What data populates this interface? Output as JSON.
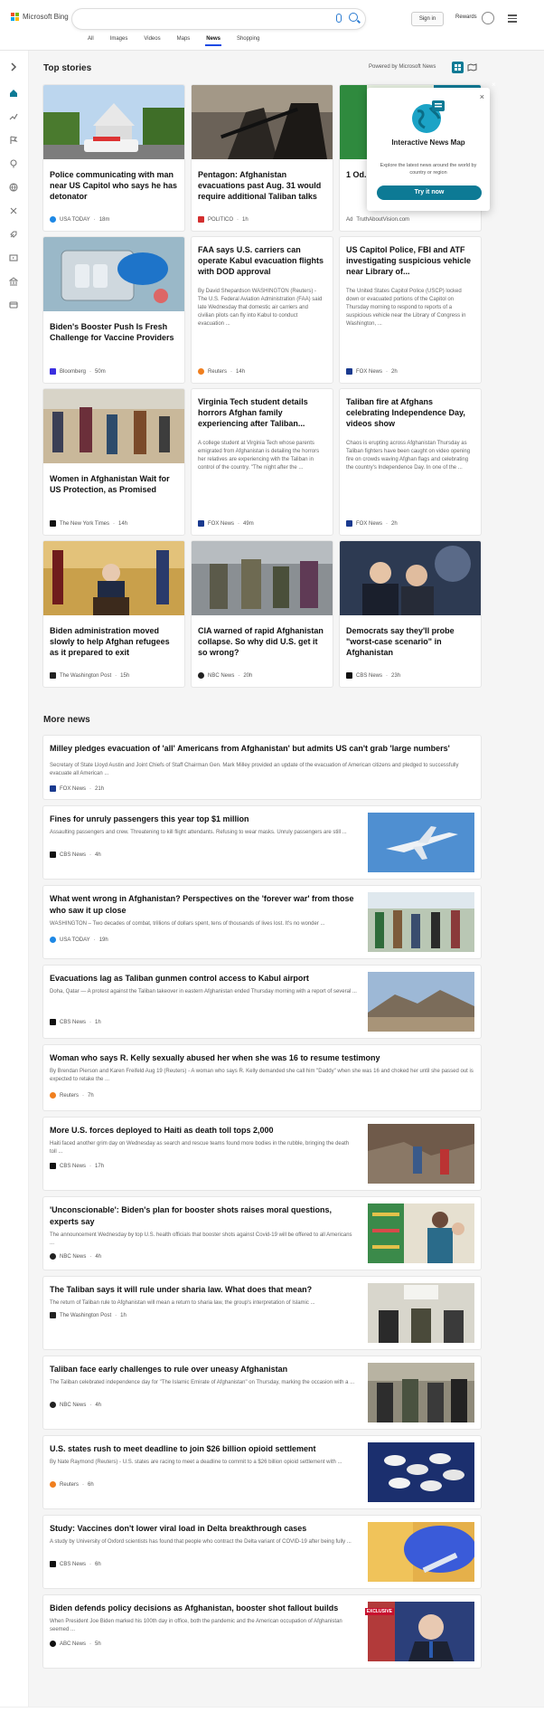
{
  "header": {
    "logo_text": "Microsoft Bing",
    "signin": "Sign in",
    "rewards": "Rewards",
    "brand_colors": [
      "#f25022",
      "#7fba00",
      "#00a4ef",
      "#ffb900"
    ]
  },
  "nav": [
    {
      "label": "All"
    },
    {
      "label": "Images"
    },
    {
      "label": "Videos"
    },
    {
      "label": "Maps"
    },
    {
      "label": "News",
      "active": true
    },
    {
      "label": "Shopping"
    }
  ],
  "top_stories": {
    "heading": "Top stories",
    "powered_by": "Powered by Microsoft News",
    "cards": [
      {
        "title": "Police communicating with man near US Capitol who says he has detonator",
        "source": "USA TODAY",
        "age": "18m",
        "logo_color": "#1e88e5"
      },
      {
        "title": "Pentagon: Afghanistan evacuations past Aug. 31 would require additional Taliban talks",
        "source": "POLITICO",
        "age": "1h",
        "logo_color": "#d32f2f"
      },
      {
        "title": "1 Od... To P...",
        "source": "TruthAboutVision.com",
        "ad_label": "Ad",
        "logo_color": "#999999"
      },
      {
        "title": "Biden's Booster Push Is Fresh Challenge for Vaccine Providers",
        "source": "Bloomberg",
        "age": "50m",
        "logo_color": "#3b2fe0"
      },
      {
        "title": "FAA says U.S. carriers can operate Kabul evacuation flights with DOD approval",
        "snippet": "By David Shepardson WASHINGTON (Reuters) -The U.S. Federal Aviation Administration (FAA) said late Wednesday that domestic air carriers and civilian pilots can fly into Kabul to conduct evacuation ...",
        "source": "Reuters",
        "age": "14h",
        "logo_color": "#f07f1f"
      },
      {
        "title": "US Capitol Police, FBI and ATF investigating suspicious vehicle near Library of...",
        "snippet": "The United States Capitol Police (USCP) locked down or evacuated portions of the Capitol on Thursday morning to respond to reports of a suspicious vehicle near the Library of Congress in Washington, ...",
        "source": "FOX News",
        "age": "2h",
        "logo_color": "#1a3a8f"
      },
      {
        "title": "Women in Afghanistan Wait for US Protection, as Promised",
        "source": "The New York Times",
        "age": "14h",
        "logo_color": "#111111"
      },
      {
        "title": "Virginia Tech student details horrors Afghan family experiencing after Taliban...",
        "snippet": "A college student at Virginia Tech whose parents emigrated from Afghanistan is detailing the horrors her relatives are experiencing with the Taliban in control of the country. \"The night after the ...",
        "source": "FOX News",
        "age": "49m",
        "logo_color": "#1a3a8f"
      },
      {
        "title": "Taliban fire at Afghans celebrating Independence Day, videos show",
        "snippet": "Chaos is erupting across Afghanistan Thursday as Taliban fighters have been caught on video opening fire on crowds waving Afghan flags and celebrating the country's Independence Day. In one of the ...",
        "source": "FOX News",
        "age": "2h",
        "logo_color": "#1a3a8f"
      },
      {
        "title": "Biden administration moved slowly to help Afghan refugees as it prepared to exit",
        "source": "The Washington Post",
        "age": "15h",
        "logo_color": "#222222"
      },
      {
        "title": "CIA warned of rapid Afghanistan collapse. So why did U.S. get it so wrong?",
        "source": "NBC News",
        "age": "20h",
        "logo_color": "#222222"
      },
      {
        "title": "Democrats say they'll probe \"worst-case scenario\" in Afghanistan",
        "source": "CBS News",
        "age": "23h",
        "logo_color": "#111111"
      }
    ]
  },
  "popup": {
    "title": "Interactive News Map",
    "description": "Explore the latest news around the world by country or region",
    "button": "Try it now"
  },
  "more_news": {
    "heading": "More news",
    "items": [
      {
        "title": "Milley pledges evacuation of 'all' Americans from Afghanistan' but admits US can't grab 'large numbers'",
        "snippet": "Secretary of State Lloyd Austin and Joint Chiefs of Staff Chairman Gen. Mark Milley provided an update of the evacuation of American citizens and pledged to successfully evacuate all American ...",
        "source": "FOX News",
        "age": "21h",
        "logo_color": "#1a3a8f",
        "has_image": false
      },
      {
        "title": "Fines for unruly passengers this year top $1 million",
        "snippet": "Assaulting passengers and crew. Threatening to kill flight attendants. Refusing to wear masks. Unruly passengers are still ...",
        "source": "CBS News",
        "age": "4h",
        "logo_color": "#111111",
        "has_image": true
      },
      {
        "title": "What went wrong in Afghanistan? Perspectives on the 'forever war' from those who saw it up close",
        "snippet": "WASHINGTON – Two decades of combat, trillions of dollars spent, tens of thousands of lives lost. It's no wonder ...",
        "source": "USA TODAY",
        "age": "19h",
        "logo_color": "#1e88e5",
        "has_image": true
      },
      {
        "title": "Evacuations lag as Taliban gunmen control access to Kabul airport",
        "snippet": "Doha, Qatar — A protest against the Taliban takeover in eastern Afghanistan ended Thursday morning with a report of several ...",
        "source": "CBS News",
        "age": "1h",
        "logo_color": "#111111",
        "has_image": true
      },
      {
        "title": "Woman who says R. Kelly sexually abused her when she was 16 to resume testimony",
        "snippet": "By Brendan Pierson and Karen Freifeld Aug 19 (Reuters) - A woman who says R. Kelly demanded she call him \"Daddy\" when she was 16 and choked her until she passed out is expected to retake the ...",
        "source": "Reuters",
        "age": "7h",
        "logo_color": "#f07f1f",
        "has_image": false
      },
      {
        "title": "More U.S. forces deployed to Haiti as death toll tops 2,000",
        "snippet": "Haiti faced another grim day on Wednesday as search and rescue teams found more bodies in the rubble, bringing the death toll ...",
        "source": "CBS News",
        "age": "17h",
        "logo_color": "#111111",
        "has_image": true
      },
      {
        "title": "'Unconscionable': Biden's plan for booster shots raises moral questions, experts say",
        "snippet": "The announcement Wednesday by top U.S. health officials that booster shots against Covid-19 will be offered to all Americans ...",
        "source": "NBC News",
        "age": "4h",
        "logo_color": "#222222",
        "has_image": true
      },
      {
        "title": "The Taliban says it will rule under sharia law. What does that mean?",
        "snippet": "The return of Taliban rule to Afghanistan will mean a return to sharia law, the group's interpretation of Islamic ...",
        "source": "The Washington Post",
        "age": "1h",
        "logo_color": "#222222",
        "has_image": true
      },
      {
        "title": "Taliban face early challenges to rule over uneasy Afghanistan",
        "snippet": "The Taliban celebrated independence day for \"The Islamic Emirate of Afghanistan\" on Thursday, marking the occasion with a ...",
        "source": "NBC News",
        "age": "4h",
        "logo_color": "#222222",
        "has_image": true
      },
      {
        "title": "U.S. states rush to meet deadline to join $26 billion opioid settlement",
        "snippet": "By Nate Raymond (Reuters) - U.S. states are racing to meet a deadline to commit to a $26 billion opioid settlement with ...",
        "source": "Reuters",
        "age": "6h",
        "logo_color": "#f07f1f",
        "has_image": true
      },
      {
        "title": "Study: Vaccines don't lower viral load in Delta breakthrough cases",
        "snippet": "A study by University of Oxford scientists has found that people who contract the Delta variant of COVID-19 after being fully ...",
        "source": "CBS News",
        "age": "6h",
        "logo_color": "#111111",
        "has_image": true
      },
      {
        "title": "Biden defends policy decisions as Afghanistan, booster shot fallout builds",
        "snippet": "When President Joe Biden marked his 100th day in office, both the pandemic and the American occupation of Afghanistan seemed ...",
        "source": "ABC News",
        "age": "5h",
        "logo_color": "#111111",
        "has_image": true,
        "image_badge": "EXCLUSIVE"
      }
    ]
  }
}
